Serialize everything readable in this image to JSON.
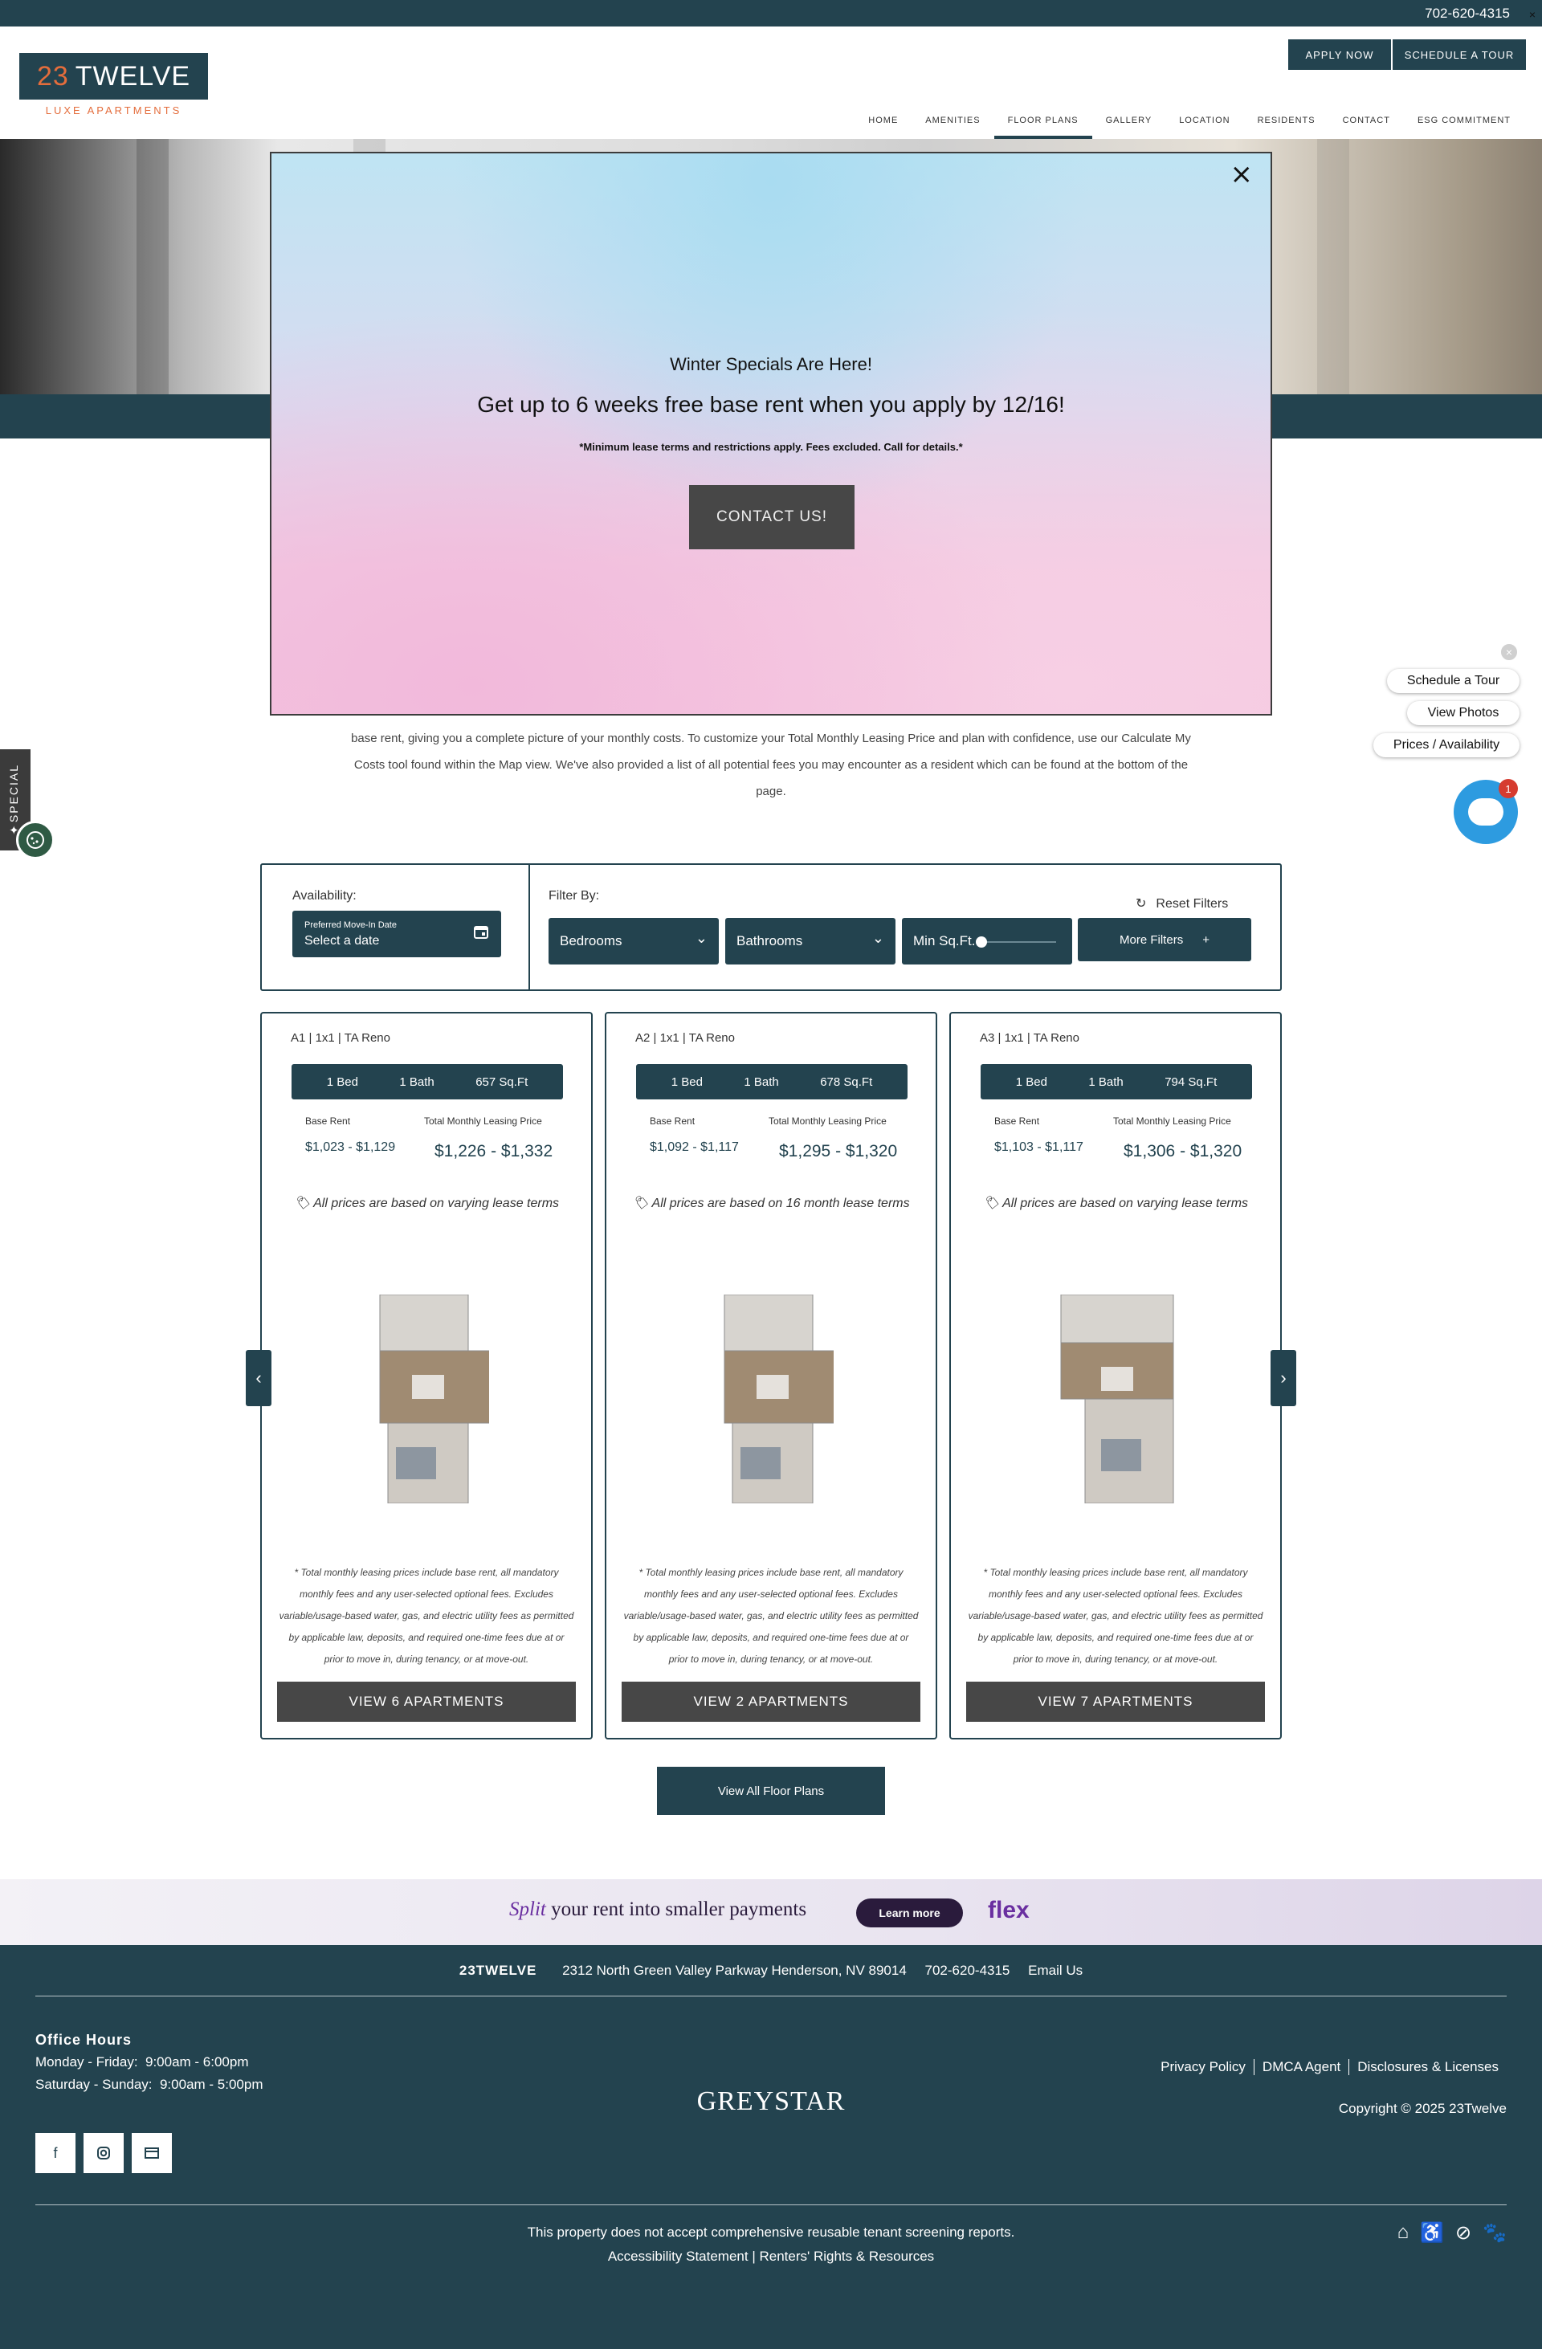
{
  "topbar": {
    "phone": "702-620-4315",
    "close": "×"
  },
  "logo": {
    "number": "23",
    "word": "TWELVE",
    "tagline": "LUXE APARTMENTS"
  },
  "header": {
    "apply_label": "APPLY NOW",
    "tour_label": "SCHEDULE A TOUR"
  },
  "nav": [
    "HOME",
    "AMENITIES",
    "FLOOR PLANS",
    "GALLERY",
    "LOCATION",
    "RESIDENTS",
    "CONTACT",
    "ESG COMMITMENT"
  ],
  "modal": {
    "close": "×",
    "heading": "Winter Specials Are Here!",
    "offer": "Get up to 6 weeks free base rent when you apply by 12/16!",
    "note": "*Minimum lease terms and restrictions apply. Fees excluded. Call for details.*",
    "button": "CONTACT US!"
  },
  "intro": {
    "line1": "base rent, giving you a complete picture of your monthly costs. To customize your Total Monthly Leasing Price and plan with confidence, use our Calculate My",
    "line2": "Costs tool found within the Map view. We've also provided a list of all potential fees you may encounter as a resident which can be found at the bottom of the",
    "line3": "page."
  },
  "special_tab": {
    "label": "SPECIAL"
  },
  "widgets": {
    "close": "×",
    "schedule_tour": "Schedule a Tour",
    "view_photos": "View Photos",
    "prices": "Prices / Availability",
    "chat_badge": "1"
  },
  "filters": {
    "availability_label": "Availability:",
    "date_small": "Preferred Move-In Date",
    "date_value": "Select a date",
    "filter_label": "Filter By:",
    "reset": "Reset Filters",
    "bedrooms": "Bedrooms",
    "bathrooms": "Bathrooms",
    "min_sqft": "Min Sq.Ft.",
    "more": "More Filters"
  },
  "cards": [
    {
      "title": "A1 | 1x1 | TA Reno",
      "beds": "1 Bed",
      "baths": "1 Bath",
      "sqft": "657 Sq.Ft",
      "base_label": "Base Rent",
      "total_label": "Total Monthly Leasing Price",
      "base": "$1,023 - $1,129",
      "total": "$1,226 - $1,332",
      "note": "All prices are based on varying lease terms",
      "disclaimer": "* Total monthly leasing prices include base rent, all mandatory monthly fees and any user-selected optional fees. Excludes variable/usage-based water, gas, and electric utility fees as permitted by applicable law, deposits, and required one-time fees due at or prior to move in, during tenancy, or at move-out.",
      "button": "VIEW 6 APARTMENTS"
    },
    {
      "title": "A2 | 1x1 | TA Reno",
      "beds": "1 Bed",
      "baths": "1 Bath",
      "sqft": "678 Sq.Ft",
      "base_label": "Base Rent",
      "total_label": "Total Monthly Leasing Price",
      "base": "$1,092 - $1,117",
      "total": "$1,295 - $1,320",
      "note": "All prices are based on 16 month lease terms",
      "disclaimer": "* Total monthly leasing prices include base rent, all mandatory monthly fees and any user-selected optional fees. Excludes variable/usage-based water, gas, and electric utility fees as permitted by applicable law, deposits, and required one-time fees due at or prior to move in, during tenancy, or at move-out.",
      "button": "VIEW 2 APARTMENTS"
    },
    {
      "title": "A3 | 1x1 | TA Reno",
      "beds": "1 Bed",
      "baths": "1 Bath",
      "sqft": "794 Sq.Ft",
      "base_label": "Base Rent",
      "total_label": "Total Monthly Leasing Price",
      "base": "$1,103 - $1,117",
      "total": "$1,306 - $1,320",
      "note": "All prices are based on varying lease terms",
      "disclaimer": "* Total monthly leasing prices include base rent, all mandatory monthly fees and any user-selected optional fees. Excludes variable/usage-based water, gas, and electric utility fees as permitted by applicable law, deposits, and required one-time fees due at or prior to move in, during tenancy, or at move-out.",
      "button": "VIEW 7 APARTMENTS"
    }
  ],
  "view_all": "View All Floor Plans",
  "flex": {
    "split_word": "Split",
    "split_rest": "your rent into smaller payments",
    "learn": "Learn more",
    "brand": "flex"
  },
  "footer": {
    "brand": "23TWELVE",
    "address": "2312 North Green Valley Parkway Henderson, NV 89014",
    "phone": "702-620-4315",
    "email": "Email Us",
    "office_title": "Office Hours",
    "hours_weekday": "Monday - Friday:  9:00am - 6:00pm",
    "hours_weekend": "Saturday - Sunday:  9:00am - 5:00pm",
    "manager": "GREYSTAR",
    "links": [
      "Privacy Policy",
      "DMCA Agent",
      "Disclosures & Licenses"
    ],
    "copyright": "Copyright © 2025 23Twelve",
    "screening": "This property does not accept comprehensive reusable tenant screening reports.",
    "accessibility": "Accessibility Statement | Renters' Rights & Resources"
  },
  "colors": {
    "brand": "#23434f",
    "accent": "#e46d3c",
    "button_dark": "#474747"
  }
}
